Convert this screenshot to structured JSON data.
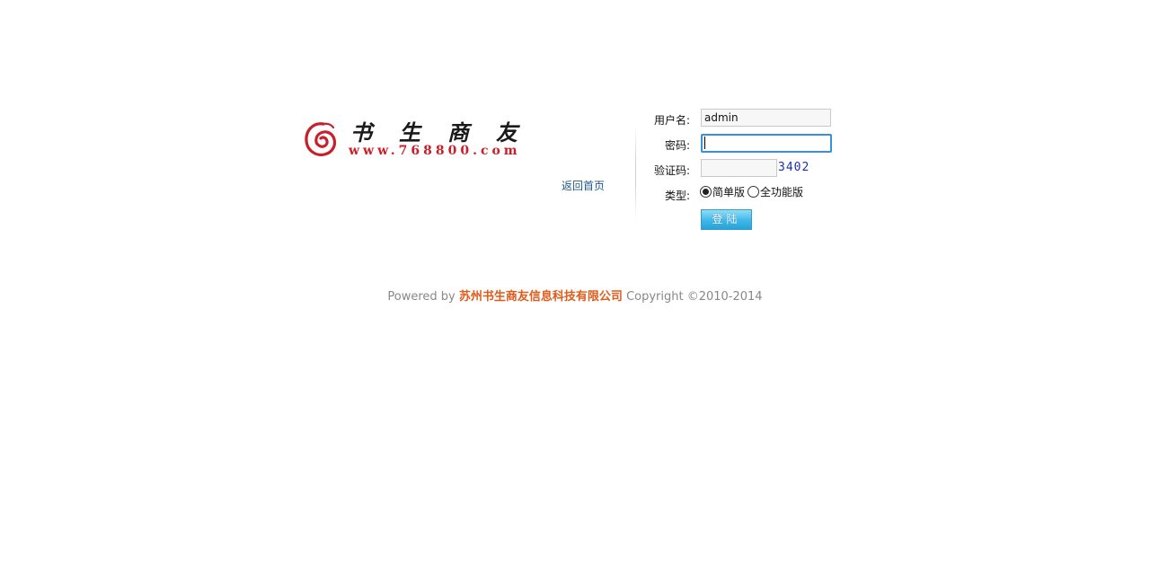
{
  "logo": {
    "brand_text": "书生商友",
    "url_text": "www.768800.com"
  },
  "home_link": "返回首页",
  "form": {
    "username_label": "用户名:",
    "username_value": "admin",
    "password_label": "密码:",
    "password_value": "",
    "code_label": "验证码:",
    "code_value": "",
    "captcha_text": "3402",
    "type_label": "类型:",
    "type_options": [
      {
        "label": "简单版",
        "checked": true
      },
      {
        "label": "全功能版",
        "checked": false
      }
    ],
    "login_button": "登陆"
  },
  "footer": {
    "prefix": "Powered by",
    "company": "苏州书生商友信息科技有限公司",
    "suffix": "Copyright ©2010-2014"
  },
  "colors": {
    "logo_red": "#c8202a",
    "link_blue": "#1f5a8a",
    "company_orange": "#e05a1b",
    "footer_gray": "#888888",
    "captcha_blue": "#1b2fa8",
    "button_blue": "#3fb8e8"
  }
}
